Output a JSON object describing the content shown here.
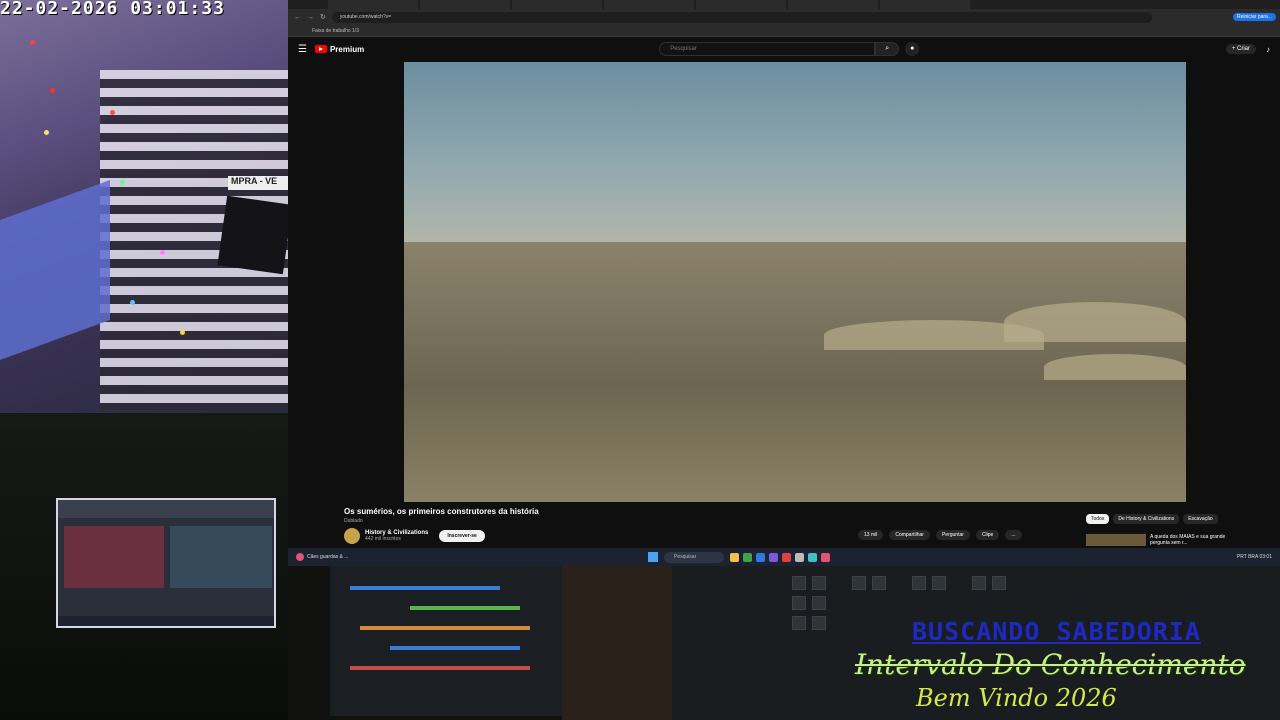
{
  "camera": {
    "timestamp": "22-02-2026 03:01:33",
    "sign_text": "MPRA - VE"
  },
  "browser": {
    "tabs": [
      "",
      "",
      "",
      "",
      "",
      "",
      ""
    ],
    "address": "youtube.com/watch?v=",
    "update_label": "Reiniciar para...",
    "bookmark": "Faixa de trabalho 1/3"
  },
  "youtube": {
    "logo": "Premium",
    "search_placeholder": "Pesquisar",
    "create_label": "+ Criar",
    "video_title": "Os sumérios, os primeiros construtores da história",
    "video_sub": "Dublado",
    "channel_name": "History & Civilizations",
    "channel_subs": "442 mil inscritos",
    "subscribe_label": "Inscrever-se",
    "actions": [
      "13 mil",
      "Compartilhar",
      "Perguntar",
      "Clipe",
      "..."
    ],
    "chips": [
      "Todos",
      "De History & Civilizations",
      "Escavação"
    ],
    "rec_title": "A queda dos MAIAS e sua grande pergunta sem r..."
  },
  "taskbar": {
    "notification": "Cães guardas & ...",
    "search_placeholder": "Pesquisar",
    "tray": "PRT  BRA  03:01"
  },
  "overlay": {
    "line1": "BUSCANDO SABEDORIA",
    "line2": "Intervalo Do Conhecimento",
    "line3": "Bem Vindo 2026"
  },
  "colors": {
    "youtube_red": "#ff0000",
    "overlay_blue": "#1f2be0",
    "overlay_green": "#c8f08a",
    "overlay_yellow": "#d7e84c"
  }
}
